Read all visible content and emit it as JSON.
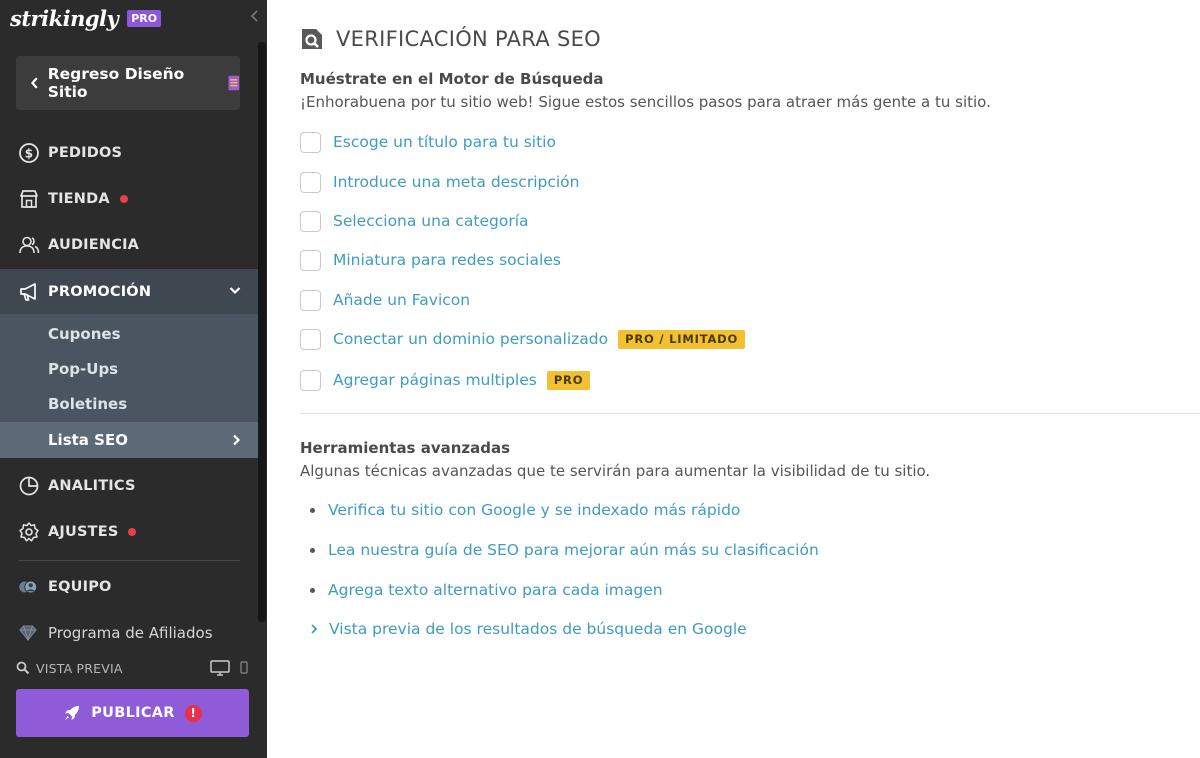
{
  "sidebar": {
    "logo": "strikingly",
    "plan_badge": "PRO",
    "back_button": "Regreso Diseño Sitio",
    "nav": {
      "pedidos": "PEDIDOS",
      "tienda": "TIENDA",
      "audiencia": "AUDIENCIA",
      "promocion": "PROMOCIÓN",
      "analitics": "ANALITICS",
      "ajustes": "AJUSTES",
      "equipo": "EQUIPO"
    },
    "submenu": {
      "cupones": "Cupones",
      "popups": "Pop-Ups",
      "boletines": "Boletines",
      "lista_seo": "Lista SEO"
    },
    "afiliados": "Programa de Afiliados",
    "preview": "VISTA PREVIA",
    "publish": "PUBLICAR",
    "publish_alert": "!"
  },
  "main": {
    "title": "VERIFICACIÓN PARA SEO",
    "section1": {
      "title": "Muéstrate en el Motor de Búsqueda",
      "desc": "¡Enhorabuena por tu sitio web! Sigue estos sencillos pasos para atraer más gente a tu sitio.",
      "items": [
        {
          "label": "Escoge un título para tu sitio",
          "checked": false
        },
        {
          "label": "Introduce una meta descripción",
          "checked": false
        },
        {
          "label": "Selecciona una categoría",
          "checked": false
        },
        {
          "label": "Miniatura para redes sociales",
          "checked": false
        },
        {
          "label": "Añade un Favicon",
          "checked": false
        },
        {
          "label": "Conectar un dominio personalizado",
          "checked": false,
          "tag": "PRO / LIMITADO"
        },
        {
          "label": "Agregar páginas multiples",
          "checked": false,
          "tag": "PRO"
        }
      ]
    },
    "section2": {
      "title": "Herramientas avanzadas",
      "desc": "Algunas técnicas avanzadas que te servirán para aumentar la visibilidad de tu sitio.",
      "links": [
        "Verifica tu sitio con Google y se indexado más rápido",
        "Lea nuestra guía de SEO para mejorar aún más su clasificación",
        "Agrega texto alternativo para cada imagen"
      ],
      "expand_link": "Vista previa de los resultados de búsqueda en Google"
    }
  },
  "colors": {
    "sidebar_bg": "#2b2b2b",
    "link": "#3e9cc2",
    "publish": "#8f5bd9",
    "tag": "#f1c033",
    "alert_dot": "#e8404a"
  }
}
